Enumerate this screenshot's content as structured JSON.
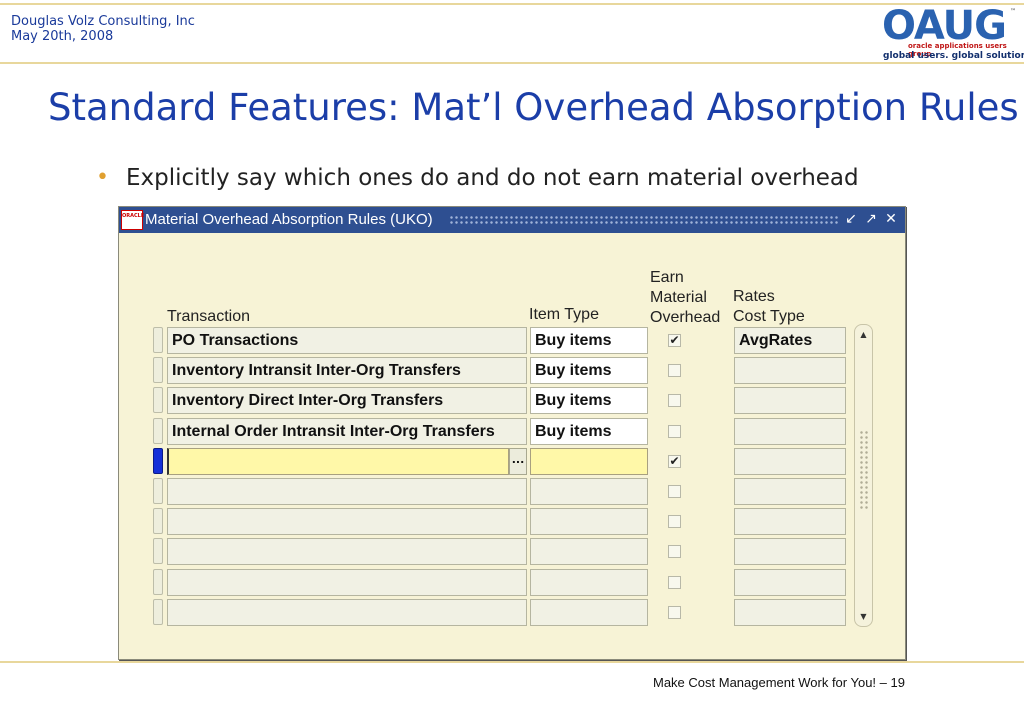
{
  "header": {
    "company": "Douglas Volz Consulting, Inc",
    "date": "May 20th, 2008",
    "logo": {
      "letters": "OAUG",
      "tm": "™",
      "subtitle": "oracle applications users group",
      "tagline": "global users. global solutions."
    }
  },
  "slide": {
    "title": "Standard Features:  Mat’l Overhead Absorption Rules",
    "bullet": "Explicitly say which ones do and do not earn material overhead"
  },
  "window": {
    "title": "Material Overhead Absorption Rules (UKO)",
    "icon_text": "ORACLE",
    "buttons": {
      "minimize": "↙",
      "maximize": "↗",
      "close": "✕"
    }
  },
  "columns": {
    "transaction": "Transaction",
    "item_type": "Item Type",
    "earn_line1": "Earn",
    "earn_line2": "Material",
    "earn_line3": "Overhead",
    "rates_line1": "Rates",
    "rates_line2": "Cost Type"
  },
  "rows": [
    {
      "transaction": "PO Transactions",
      "item_type": "Buy items",
      "earn": true,
      "cost_type": "AvgRates"
    },
    {
      "transaction": "Inventory Intransit Inter-Org Transfers",
      "item_type": "Buy items",
      "earn": false,
      "cost_type": ""
    },
    {
      "transaction": "Inventory Direct Inter-Org Transfers",
      "item_type": "Buy items",
      "earn": false,
      "cost_type": ""
    },
    {
      "transaction": "Internal Order Intransit Inter-Org Transfers",
      "item_type": "Buy items",
      "earn": false,
      "cost_type": ""
    },
    {
      "transaction": "",
      "item_type": "",
      "earn": true,
      "cost_type": ""
    },
    {
      "transaction": "",
      "item_type": "",
      "earn": false,
      "cost_type": ""
    },
    {
      "transaction": "",
      "item_type": "",
      "earn": false,
      "cost_type": ""
    },
    {
      "transaction": "",
      "item_type": "",
      "earn": false,
      "cost_type": ""
    },
    {
      "transaction": "",
      "item_type": "",
      "earn": false,
      "cost_type": ""
    },
    {
      "transaction": "",
      "item_type": "",
      "earn": false,
      "cost_type": ""
    }
  ],
  "active_row": 4,
  "lov_label": "...",
  "scroll": {
    "up": "▲",
    "down": "▼"
  },
  "check_mark": "✔",
  "footer": {
    "text": "Make Cost Management Work for You! – 19"
  },
  "colors": {
    "title": "#1b3ea8",
    "titlebar": "#2e4f91",
    "accent_line": "#e8d79c",
    "active_field": "#fff8a8"
  }
}
